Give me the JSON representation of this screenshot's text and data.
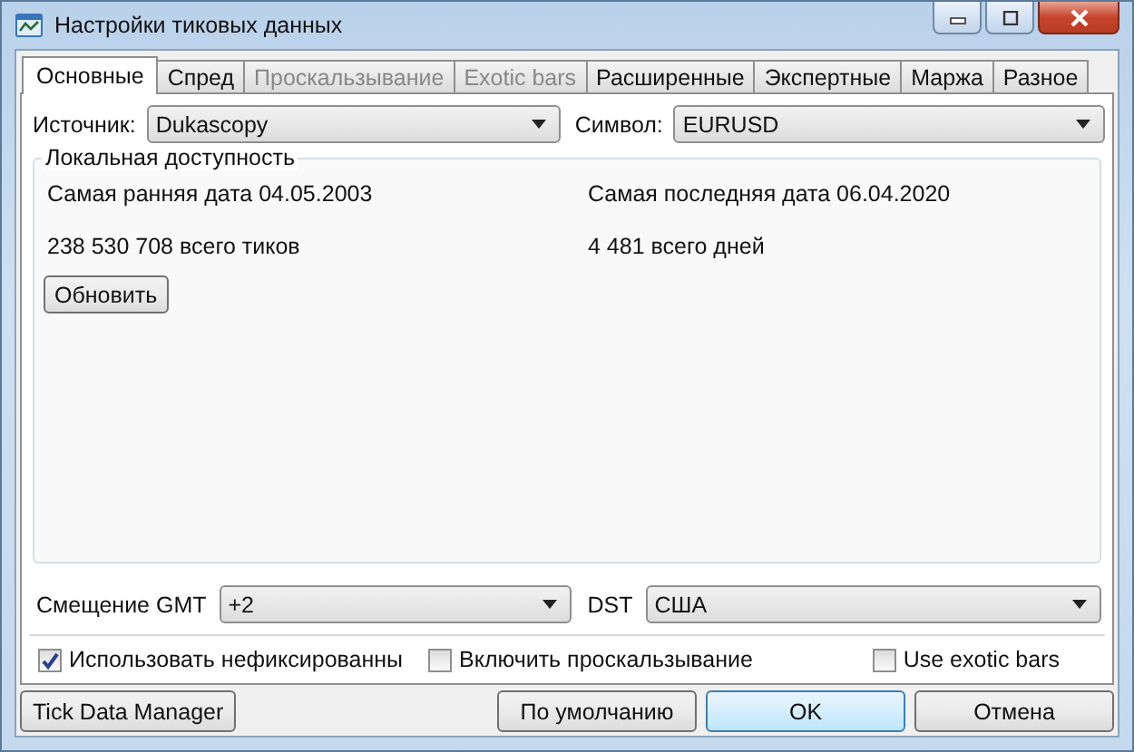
{
  "window": {
    "title": "Настройки тиковых данных"
  },
  "tabs": [
    {
      "label": "Основные",
      "selected": true,
      "disabled": false
    },
    {
      "label": "Спред",
      "selected": false,
      "disabled": false
    },
    {
      "label": "Проскальзывание",
      "selected": false,
      "disabled": true
    },
    {
      "label": "Exotic bars",
      "selected": false,
      "disabled": true
    },
    {
      "label": "Расширенные",
      "selected": false,
      "disabled": false
    },
    {
      "label": "Экспертные",
      "selected": false,
      "disabled": false
    },
    {
      "label": "Маржа",
      "selected": false,
      "disabled": false
    },
    {
      "label": "Разное",
      "selected": false,
      "disabled": false
    }
  ],
  "source": {
    "label": "Источник:",
    "value": "Dukascopy"
  },
  "symbol": {
    "label": "Символ:",
    "value": "EURUSD"
  },
  "local": {
    "title": "Локальная доступность",
    "earliest": "Самая ранняя дата 04.05.2003",
    "latest": "Самая последняя дата 06.04.2020",
    "ticks": "238 530 708 всего тиков",
    "days": "4 481 всего дней",
    "refresh": "Обновить"
  },
  "gmt": {
    "label": "Смещение GMT",
    "value": "+2"
  },
  "dst": {
    "label": "DST",
    "value": "США"
  },
  "options": [
    {
      "label": "Использовать нефиксированны",
      "checked": true
    },
    {
      "label": "Включить проскальзывание",
      "checked": false
    },
    {
      "label": "Use exotic bars",
      "checked": false
    }
  ],
  "buttons": {
    "manager": "Tick Data Manager",
    "default": "По умолчанию",
    "ok": "OK",
    "cancel": "Отмена"
  }
}
